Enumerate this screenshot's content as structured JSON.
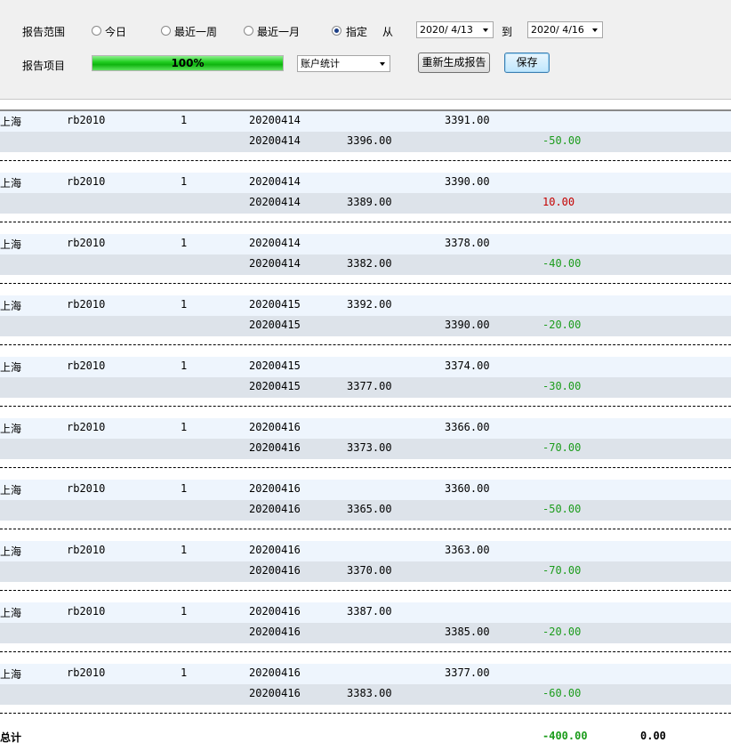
{
  "toolbar": {
    "range_label": "报告范围",
    "radios": [
      {
        "label": "今日",
        "checked": false
      },
      {
        "label": "最近一周",
        "checked": false
      },
      {
        "label": "最近一月",
        "checked": false
      },
      {
        "label": "指定",
        "checked": true
      }
    ],
    "from_label": "从",
    "from_date": "2020/ 4/13",
    "to_label": "到",
    "to_date": "2020/ 4/16",
    "item_label": "报告项目",
    "progress_percent": 100,
    "progress_text": "100%",
    "report_type": "账户统计",
    "regenerate_label": "重新生成报告",
    "save_label": "保存"
  },
  "colors": {
    "profit": "#c40000",
    "loss": "#1c9c1c"
  },
  "trades": [
    {
      "exchange": "上海",
      "symbol": "rb2010",
      "qty": "1",
      "open": {
        "date": "20200414",
        "buy": "",
        "sell": "3391.00"
      },
      "close": {
        "date": "20200414",
        "buy": "3396.00",
        "sell": "",
        "pnl": "-50.00",
        "sign": "loss"
      }
    },
    {
      "exchange": "上海",
      "symbol": "rb2010",
      "qty": "1",
      "open": {
        "date": "20200414",
        "buy": "",
        "sell": "3390.00"
      },
      "close": {
        "date": "20200414",
        "buy": "3389.00",
        "sell": "",
        "pnl": "10.00",
        "sign": "profit"
      }
    },
    {
      "exchange": "上海",
      "symbol": "rb2010",
      "qty": "1",
      "open": {
        "date": "20200414",
        "buy": "",
        "sell": "3378.00"
      },
      "close": {
        "date": "20200414",
        "buy": "3382.00",
        "sell": "",
        "pnl": "-40.00",
        "sign": "loss"
      }
    },
    {
      "exchange": "上海",
      "symbol": "rb2010",
      "qty": "1",
      "open": {
        "date": "20200415",
        "buy": "3392.00",
        "sell": ""
      },
      "close": {
        "date": "20200415",
        "buy": "",
        "sell": "3390.00",
        "pnl": "-20.00",
        "sign": "loss"
      }
    },
    {
      "exchange": "上海",
      "symbol": "rb2010",
      "qty": "1",
      "open": {
        "date": "20200415",
        "buy": "",
        "sell": "3374.00"
      },
      "close": {
        "date": "20200415",
        "buy": "3377.00",
        "sell": "",
        "pnl": "-30.00",
        "sign": "loss"
      }
    },
    {
      "exchange": "上海",
      "symbol": "rb2010",
      "qty": "1",
      "open": {
        "date": "20200416",
        "buy": "",
        "sell": "3366.00"
      },
      "close": {
        "date": "20200416",
        "buy": "3373.00",
        "sell": "",
        "pnl": "-70.00",
        "sign": "loss"
      }
    },
    {
      "exchange": "上海",
      "symbol": "rb2010",
      "qty": "1",
      "open": {
        "date": "20200416",
        "buy": "",
        "sell": "3360.00"
      },
      "close": {
        "date": "20200416",
        "buy": "3365.00",
        "sell": "",
        "pnl": "-50.00",
        "sign": "loss"
      }
    },
    {
      "exchange": "上海",
      "symbol": "rb2010",
      "qty": "1",
      "open": {
        "date": "20200416",
        "buy": "",
        "sell": "3363.00"
      },
      "close": {
        "date": "20200416",
        "buy": "3370.00",
        "sell": "",
        "pnl": "-70.00",
        "sign": "loss"
      }
    },
    {
      "exchange": "上海",
      "symbol": "rb2010",
      "qty": "1",
      "open": {
        "date": "20200416",
        "buy": "3387.00",
        "sell": ""
      },
      "close": {
        "date": "20200416",
        "buy": "",
        "sell": "3385.00",
        "pnl": "-20.00",
        "sign": "loss"
      }
    },
    {
      "exchange": "上海",
      "symbol": "rb2010",
      "qty": "1",
      "open": {
        "date": "20200416",
        "buy": "",
        "sell": "3377.00"
      },
      "close": {
        "date": "20200416",
        "buy": "3383.00",
        "sell": "",
        "pnl": "-60.00",
        "sign": "loss"
      }
    }
  ],
  "total": {
    "label": "总计",
    "pnl": "-400.00",
    "other": "0.00"
  }
}
